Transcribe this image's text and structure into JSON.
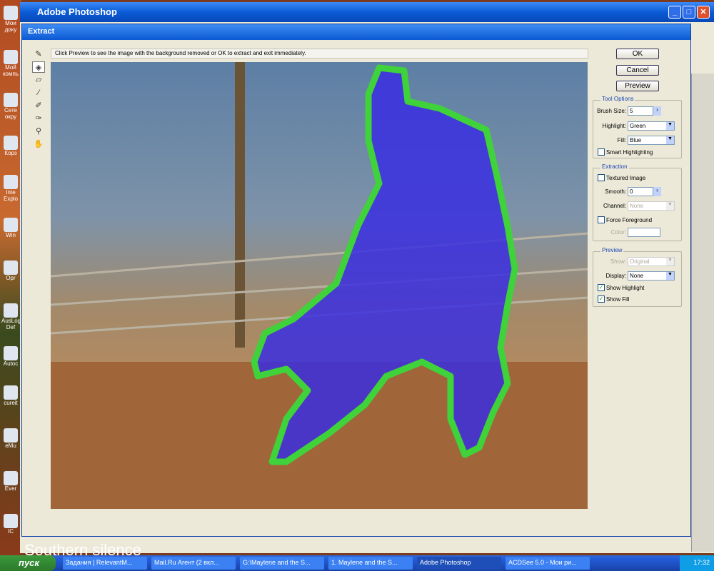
{
  "desktop": {
    "icons": [
      "Мои доку",
      "Мой компь",
      "Сете окру",
      "Корз",
      "Inte Explo",
      "Win",
      "Opr",
      "AusLog Def",
      "Autoc",
      "cureit",
      "eMu",
      "Ever",
      "IC"
    ],
    "overlay_text": "Southern silence"
  },
  "photoshop": {
    "title": "Adobe Photoshop",
    "min": "_",
    "max": "□",
    "close": "✕"
  },
  "dialog": {
    "title": "Extract",
    "message": "Click Preview to see the image with the background removed or OK to extract and exit immediately.",
    "tools": [
      "edge-highlighter-icon",
      "fill-icon",
      "eraser-icon",
      "eyedropper-icon",
      "cleanup-icon",
      "edge-touchup-icon",
      "zoom-icon",
      "hand-icon"
    ],
    "buttons": {
      "ok": "OK",
      "cancel": "Cancel",
      "preview": "Preview"
    },
    "tool_options": {
      "legend": "Tool Options",
      "brush_size_label": "Brush Size:",
      "brush_size": "5",
      "highlight_label": "Highlight:",
      "highlight": "Green",
      "fill_label": "Fill:",
      "fill": "Blue",
      "smart_highlighting": "Smart Highlighting",
      "smart_checked": false
    },
    "extraction": {
      "legend": "Extraction",
      "textured": "Textured Image",
      "textured_checked": false,
      "smooth_label": "Smooth:",
      "smooth": "0",
      "channel_label": "Channel:",
      "channel": "None",
      "force_fg": "Force Foreground",
      "force_checked": false,
      "color_label": "Color:"
    },
    "preview": {
      "legend": "Preview",
      "show_label": "Show:",
      "show": "Original",
      "display_label": "Display:",
      "display": "None",
      "show_highlight": "Show Highlight",
      "show_highlight_checked": true,
      "show_fill": "Show Fill",
      "show_fill_checked": true
    },
    "colors": {
      "highlight": "#3fd23a",
      "fill": "#3a2ee0"
    }
  },
  "taskbar": {
    "start": "пуск",
    "items": [
      "Задания | RelevantM...",
      "Mail.Ru Агент (2 вкл...",
      "G:\\Maylene and the S...",
      "1. Maylene and the S...",
      "Adobe Photoshop",
      "ACDSee 5.0 - Мои ри..."
    ],
    "active": 4,
    "clock": "17:32"
  }
}
